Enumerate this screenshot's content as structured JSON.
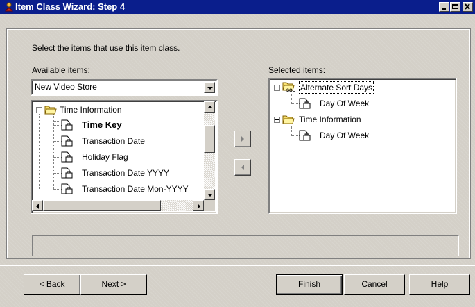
{
  "window": {
    "title": "Item Class Wizard: Step 4"
  },
  "instructions": "Select the items that use this item class.",
  "available": {
    "label_prefix": "",
    "label_accel": "A",
    "label_rest": "vailable items:",
    "combo_value": "New Video Store",
    "tree": {
      "root": "Time Information",
      "items": [
        "Time Key",
        "Transaction Date",
        "Holiday Flag",
        "Transaction Date YYYY",
        "Transaction Date Mon-YYYY"
      ]
    }
  },
  "selected": {
    "label_accel": "S",
    "label_rest": "elected items:",
    "tree": [
      {
        "name": "Alternate Sort Days",
        "icon": "sql-folder-icon",
        "children": [
          "Day Of Week"
        ]
      },
      {
        "name": "Time Information",
        "icon": "folder-icon",
        "children": [
          "Day Of Week"
        ]
      }
    ]
  },
  "buttons": {
    "back_pre": "< ",
    "back_accel": "B",
    "back_rest": "ack",
    "next_accel": "N",
    "next_rest": "ext >",
    "finish": "Finish",
    "cancel": "Cancel",
    "help_accel": "H",
    "help_rest": "elp"
  },
  "colors": {
    "titlebar": "#0a1e8c",
    "face": "#d4d0c8"
  }
}
